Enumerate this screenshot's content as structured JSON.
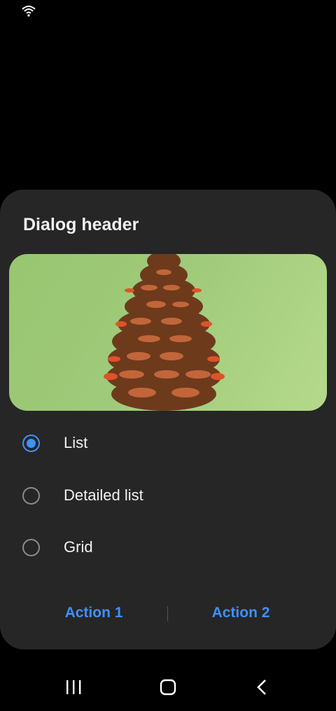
{
  "dialog": {
    "title": "Dialog header",
    "options": [
      {
        "label": "List",
        "selected": true
      },
      {
        "label": "Detailed list",
        "selected": false
      },
      {
        "label": "Grid",
        "selected": false
      }
    ],
    "actions": {
      "primary": "Action 1",
      "secondary": "Action 2"
    }
  },
  "colors": {
    "accent": "#3e91ff",
    "dialog_bg": "#262626",
    "image_bg": "#9fca7a"
  },
  "icons": {
    "status": "wifi-icon",
    "image": "pinecone-image",
    "nav": [
      "recent-apps-icon",
      "home-icon",
      "back-icon"
    ]
  }
}
